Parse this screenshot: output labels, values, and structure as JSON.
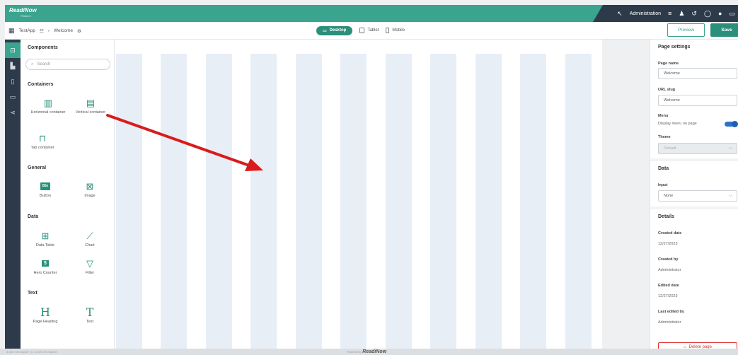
{
  "app": {
    "logo": "ReadiNow",
    "logo_sub": "Platform"
  },
  "topbar": {
    "user": "Administration",
    "colors": {
      "teal": "#3aa48e",
      "dark": "#2d3a4a"
    }
  },
  "breadcrumb": {
    "app": "TestApp",
    "page": "Welcome"
  },
  "devices": {
    "desktop": "Desktop",
    "tablet": "Tablet",
    "mobile": "Mobile"
  },
  "actions": {
    "preview": "Preview",
    "save": "Save"
  },
  "components": {
    "title": "Components",
    "search_placeholder": "Search",
    "containers_title": "Containers",
    "horizontal": "Horizontal container",
    "vertical": "Vertical container",
    "tab": "Tab container",
    "general_title": "General",
    "button_badge": "Btn",
    "button": "Button",
    "image": "Image",
    "data_title": "Data",
    "data_table": "Data Table",
    "chart": "Chart",
    "hero_badge": "5",
    "hero": "Hero Counter",
    "filter": "Filter",
    "text_title": "Text",
    "heading_glyph": "H",
    "heading": "Page Heading",
    "text_glyph": "T",
    "text": "Text"
  },
  "page_settings": {
    "title": "Page settings",
    "page_name_label": "Page name",
    "page_name": "Welcome",
    "url_slug_label": "URL slug",
    "url_slug": "Welcome",
    "menu_label": "Menu",
    "menu_toggle_label": "Display menu on page",
    "theme_label": "Theme",
    "theme": "Default"
  },
  "data_section": {
    "title": "Data",
    "input_label": "Input",
    "input": "None"
  },
  "details": {
    "title": "Details",
    "created_date_label": "Created date",
    "created_date": "12/27/2023",
    "created_by_label": "Created by",
    "created_by": "Administrator",
    "edited_date_label": "Edited date",
    "edited_date": "12/27/2023",
    "last_edited_label": "Last edited by",
    "last_edited": "Administrator",
    "delete": "Delete page"
  },
  "status": {
    "left": "3.169.739-Sunset | C: 3.169.739-Sunset",
    "powered": "Powered by",
    "brand": "ReadiNow"
  }
}
